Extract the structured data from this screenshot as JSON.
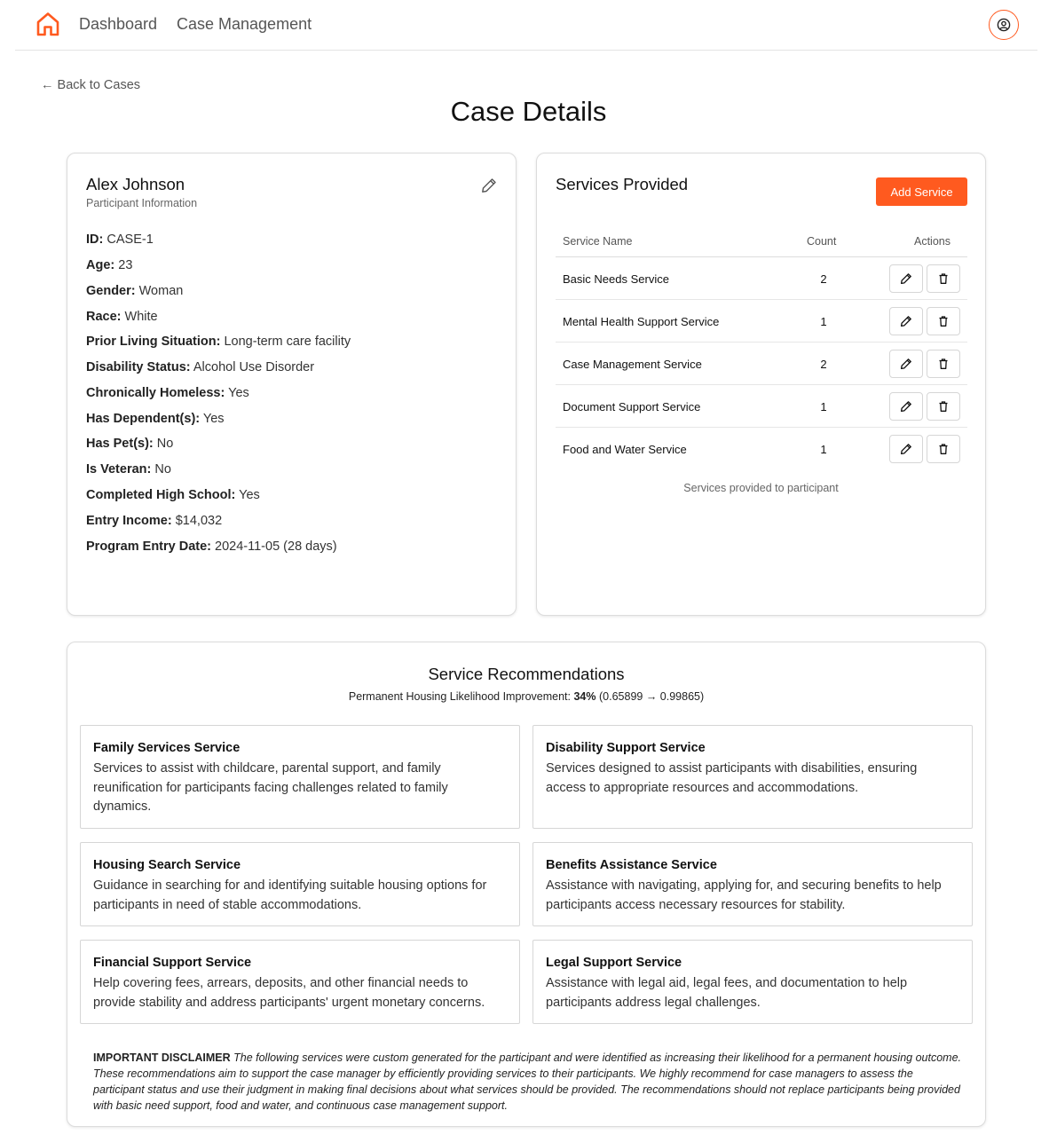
{
  "nav": {
    "dashboard": "Dashboard",
    "case_management": "Case Management"
  },
  "back_link": "← Back to Cases",
  "page_title": "Case Details",
  "participant": {
    "name": "Alex Johnson",
    "subtitle": "Participant Information",
    "fields": [
      {
        "label": "ID:",
        "value": "CASE-1"
      },
      {
        "label": "Age:",
        "value": "23"
      },
      {
        "label": "Gender:",
        "value": "Woman"
      },
      {
        "label": "Race:",
        "value": "White"
      },
      {
        "label": "Prior Living Situation:",
        "value": "Long-term care facility"
      },
      {
        "label": "Disability Status:",
        "value": "Alcohol Use Disorder"
      },
      {
        "label": "Chronically Homeless:",
        "value": "Yes"
      },
      {
        "label": "Has Dependent(s):",
        "value": "Yes"
      },
      {
        "label": "Has Pet(s):",
        "value": "No"
      },
      {
        "label": "Is Veteran:",
        "value": "No"
      },
      {
        "label": "Completed High School:",
        "value": "Yes"
      },
      {
        "label": "Entry Income:",
        "value": "$14,032"
      },
      {
        "label": "Program Entry Date:",
        "value": "2024-11-05 (28 days)"
      }
    ]
  },
  "services": {
    "title": "Services Provided",
    "add_button": "Add Service",
    "columns": [
      "Service Name",
      "Count",
      "Actions"
    ],
    "rows": [
      {
        "name": "Basic Needs Service",
        "count": "2"
      },
      {
        "name": "Mental Health Support Service",
        "count": "1"
      },
      {
        "name": "Case Management Service",
        "count": "2"
      },
      {
        "name": "Document Support Service",
        "count": "1"
      },
      {
        "name": "Food and Water Service",
        "count": "1"
      }
    ],
    "caption": "Services provided to participant"
  },
  "recommendations": {
    "title": "Service Recommendations",
    "improvement_label": "Permanent Housing Likelihood Improvement:",
    "improvement_value": "34%",
    "improvement_detail": "(0.65899 → 0.99865)",
    "items": [
      {
        "name": "Family Services Service",
        "description": "Services to assist with childcare, parental support, and family reunification for participants facing challenges related to family dynamics."
      },
      {
        "name": "Disability Support Service",
        "description": "Services designed to assist participants with disabilities, ensuring access to appropriate resources and accommodations."
      },
      {
        "name": "Housing Search Service",
        "description": "Guidance in searching for and identifying suitable housing options for participants in need of stable accommodations."
      },
      {
        "name": "Benefits Assistance Service",
        "description": "Assistance with navigating, applying for, and securing benefits to help participants access necessary resources for stability."
      },
      {
        "name": "Financial Support Service",
        "description": "Help covering fees, arrears, deposits, and other financial needs to provide stability and address participants' urgent monetary concerns."
      },
      {
        "name": "Legal Support Service",
        "description": "Assistance with legal aid, legal fees, and documentation to help participants address legal challenges."
      }
    ],
    "disclaimer_label": "IMPORTANT DISCLAIMER",
    "disclaimer_text": "The following services were custom generated for the participant and were identified as increasing their likelihood for a permanent housing outcome. These recommendations aim to support the case manager by efficiently providing services to their participants. We highly recommend for case managers to assess the participant status and use their judgment in making final decisions about what services should be provided. The recommendations should not replace participants being provided with basic need support, food and water, and continuous case management support."
  },
  "icons": {
    "home": "home-icon",
    "user": "user-circle-icon",
    "edit": "pencil-icon",
    "delete": "trash-icon"
  },
  "colors": {
    "accent": "#ff5a1f"
  }
}
